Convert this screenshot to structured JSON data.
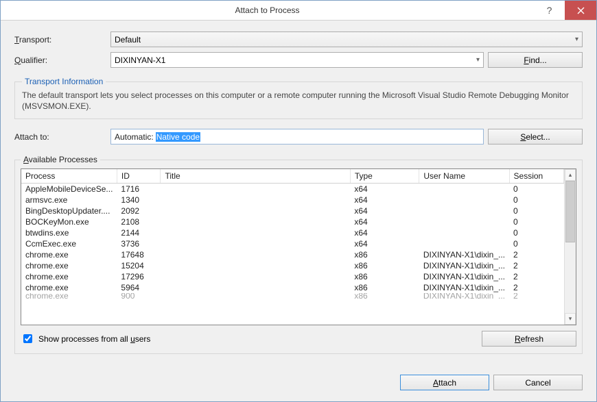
{
  "title": "Attach to Process",
  "transport": {
    "label": "Transport:",
    "value": "Default"
  },
  "qualifier": {
    "label": "Qualifier:",
    "value": "DIXINYAN-X1",
    "find_btn": "Find..."
  },
  "transport_info": {
    "legend": "Transport Information",
    "desc": "The default transport lets you select processes on this computer or a remote computer running the Microsoft Visual Studio Remote Debugging Monitor (MSVSMON.EXE)."
  },
  "attach_to": {
    "label": "Attach to:",
    "prefix": "Automatic: ",
    "highlighted": "Native code",
    "select_btn": "Select..."
  },
  "available": {
    "legend": "Available Processes",
    "columns": {
      "process": "Process",
      "id": "ID",
      "title": "Title",
      "type": "Type",
      "user": "User Name",
      "session": "Session"
    },
    "rows": [
      {
        "process": "AppleMobileDeviceSe...",
        "id": "1716",
        "title": "",
        "type": "x64",
        "user": "",
        "session": "0"
      },
      {
        "process": "armsvc.exe",
        "id": "1340",
        "title": "",
        "type": "x64",
        "user": "",
        "session": "0"
      },
      {
        "process": "BingDesktopUpdater....",
        "id": "2092",
        "title": "",
        "type": "x64",
        "user": "",
        "session": "0"
      },
      {
        "process": "BOCKeyMon.exe",
        "id": "2108",
        "title": "",
        "type": "x64",
        "user": "",
        "session": "0"
      },
      {
        "process": "btwdins.exe",
        "id": "2144",
        "title": "",
        "type": "x64",
        "user": "",
        "session": "0"
      },
      {
        "process": "CcmExec.exe",
        "id": "3736",
        "title": "",
        "type": "x64",
        "user": "",
        "session": "0"
      },
      {
        "process": "chrome.exe",
        "id": "17648",
        "title": "",
        "type": "x86",
        "user": "DIXINYAN-X1\\dixin_...",
        "session": "2"
      },
      {
        "process": "chrome.exe",
        "id": "15204",
        "title": "",
        "type": "x86",
        "user": "DIXINYAN-X1\\dixin_...",
        "session": "2"
      },
      {
        "process": "chrome.exe",
        "id": "17296",
        "title": "",
        "type": "x86",
        "user": "DIXINYAN-X1\\dixin_...",
        "session": "2"
      },
      {
        "process": "chrome.exe",
        "id": "5964",
        "title": "",
        "type": "x86",
        "user": "DIXINYAN-X1\\dixin_...",
        "session": "2"
      }
    ],
    "cut_row": {
      "process": "chrome.exe",
      "id": "900",
      "title": "",
      "type": "x86",
      "user": "DIXINYAN-X1\\dixin_...",
      "session": "2"
    }
  },
  "show_all": {
    "checked": true,
    "label_pre": "Show processes from all ",
    "label_u": "u",
    "label_post": "sers"
  },
  "refresh_btn": "Refresh",
  "attach_btn": "Attach",
  "cancel_btn": "Cancel"
}
